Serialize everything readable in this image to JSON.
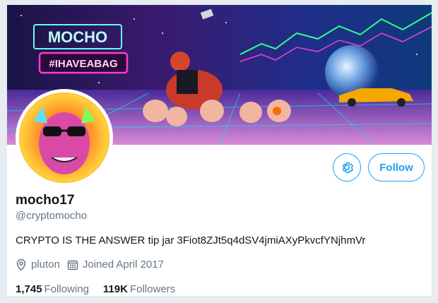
{
  "profile": {
    "banner_sign_top": "MOCHO",
    "banner_sign_bottom": "#IHAVEABAG",
    "display_name": "mocho17",
    "handle": "@cryptomocho",
    "bio": "CRYPTO IS THE ANSWER tip jar 3Fiot8ZJt5q4dSV4jmiAXyPkvcfYNjhmVr",
    "location": "pluton",
    "joined": "Joined April 2017",
    "following_count": "1,745",
    "following_label": "Following",
    "followers_count": "119K",
    "followers_label": "Followers"
  },
  "actions": {
    "follow_label": "Follow",
    "settings_icon": "gear-icon"
  },
  "colors": {
    "accent": "#1da1f2",
    "muted_text": "#657786",
    "page_bg": "#e6ecf0"
  }
}
